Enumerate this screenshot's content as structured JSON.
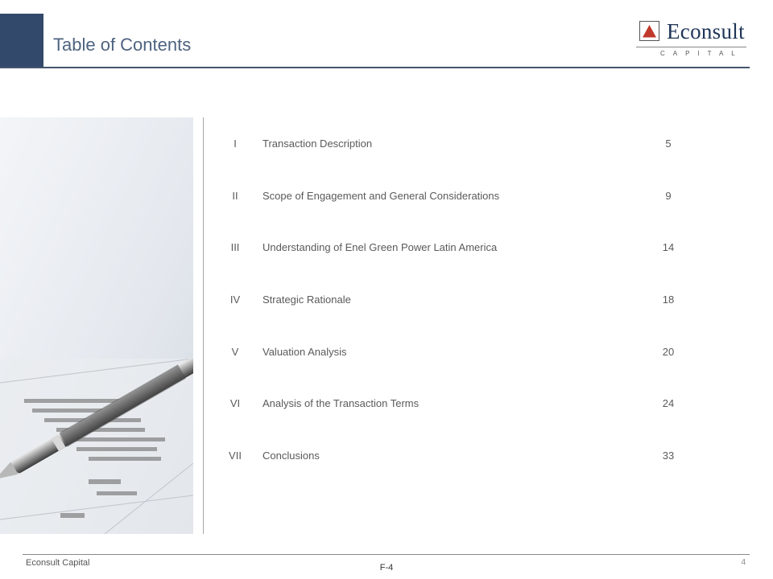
{
  "header": {
    "title": "Table of Contents"
  },
  "logo": {
    "name": "Econsult",
    "sub": "CAPITAL"
  },
  "toc": [
    {
      "num": "I",
      "title": "Transaction Description",
      "page": "5"
    },
    {
      "num": "II",
      "title": "Scope of Engagement and General Considerations",
      "page": "9"
    },
    {
      "num": "III",
      "title": "Understanding of Enel Green Power Latin America",
      "page": "14"
    },
    {
      "num": "IV",
      "title": "Strategic Rationale",
      "page": "18"
    },
    {
      "num": "V",
      "title": "Valuation Analysis",
      "page": "20"
    },
    {
      "num": "VI",
      "title": "Analysis of the Transaction Terms",
      "page": "24"
    },
    {
      "num": "VII",
      "title": "Conclusions",
      "page": "33"
    }
  ],
  "footer": {
    "left": "Econsult Capital",
    "center": "F-4",
    "page": "4"
  }
}
